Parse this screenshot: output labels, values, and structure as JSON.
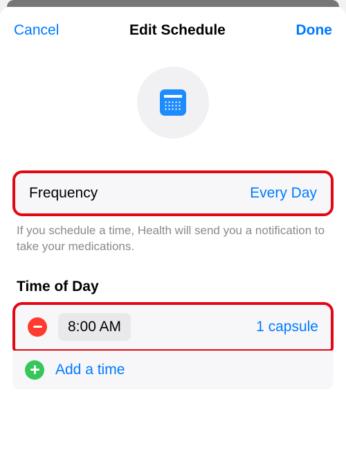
{
  "nav": {
    "cancel": "Cancel",
    "title": "Edit Schedule",
    "done": "Done"
  },
  "frequency": {
    "label": "Frequency",
    "value": "Every Day"
  },
  "hint": "If you schedule a time, Health will send you a notification to take your medications.",
  "timeOfDay": {
    "title": "Time of Day",
    "rows": [
      {
        "time": "8:00 AM",
        "dose": "1 capsule"
      }
    ],
    "addLabel": "Add a time"
  }
}
